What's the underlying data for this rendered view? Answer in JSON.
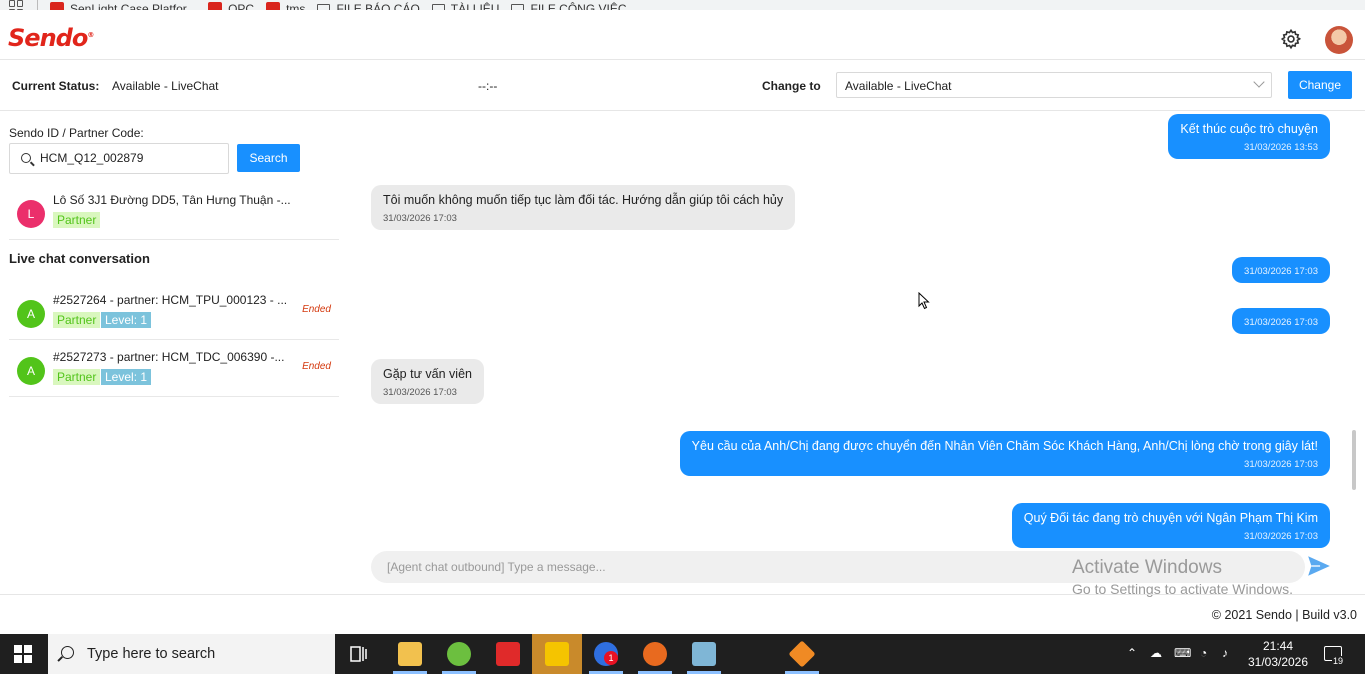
{
  "bookmarks": [
    {
      "label": "SenLight Case Platfor...",
      "icon": "sendo-red-icon"
    },
    {
      "label": "OPC",
      "icon": "sendo-red-icon"
    },
    {
      "label": "tms",
      "icon": "sendo-red-icon"
    },
    {
      "label": "FILE BÁO CÁO",
      "icon": "folder-icon"
    },
    {
      "label": "TÀI LIỆU",
      "icon": "folder-icon"
    },
    {
      "label": "FILE CÔNG VIỆC",
      "icon": "folder-icon"
    }
  ],
  "header": {
    "logo": "Sendo",
    "logo_mark": "®"
  },
  "status": {
    "current_label": "Current Status:",
    "current_value": "Available - LiveChat",
    "timer": "--:--",
    "change_to_label": "Change to",
    "select_value": "Available - LiveChat",
    "change_button": "Change"
  },
  "left": {
    "search_label": "Sendo ID / Partner Code:",
    "search_value": "HCM_Q12_002879",
    "search_button": "Search",
    "result": {
      "initial": "L",
      "title": "Lô Số 3J1 Đường DD5, Tân Hưng Thuận -...",
      "tag": "Partner"
    },
    "live_chat_heading": "Live chat conversation",
    "conversations": [
      {
        "initial": "A",
        "title": "#2527264 - partner: HCM_TPU_000123 - ...",
        "tag": "Partner",
        "level": "Level: 1",
        "status": "Ended"
      },
      {
        "initial": "A",
        "title": "#2527273 - partner: HCM_TDC_006390 -...",
        "tag": "Partner",
        "level": "Level: 1",
        "status": "Ended"
      }
    ]
  },
  "chat": {
    "messages": [
      {
        "dir": "out",
        "text": "Kết thúc cuộc trò chuyện",
        "time": "31/03/2026 13:53"
      },
      {
        "dir": "in",
        "text": "Tôi muốn không muốn tiếp tục làm đối tác. Hướng dẫn giúp tôi cách hủy",
        "time": "31/03/2026 17:03"
      },
      {
        "dir": "out",
        "text": "",
        "time": "31/03/2026 17:03"
      },
      {
        "dir": "out",
        "text": "",
        "time": "31/03/2026 17:03"
      },
      {
        "dir": "in",
        "text": "Gặp tư vấn viên",
        "time": "31/03/2026 17:03"
      },
      {
        "dir": "out",
        "text": "Yêu cầu của Anh/Chị đang được chuyển đến Nhân Viên Chăm Sóc Khách Hàng, Anh/Chị lòng chờ trong giây lát!",
        "time": "31/03/2026 17:03"
      },
      {
        "dir": "out",
        "text": "Quý Đối tác đang trò chuyện với Ngân Phạm Thị Kim",
        "time": "31/03/2026 17:03"
      }
    ],
    "composer_placeholder": "[Agent chat outbound] Type a message..."
  },
  "watermark": {
    "line1": "Activate Windows",
    "line2": "Go to Settings to activate Windows."
  },
  "footer": {
    "text": "© 2021 Sendo | Build v3.0"
  },
  "taskbar": {
    "search_placeholder": "Type here to search",
    "zalo_badge": "1",
    "time": "21:44",
    "date": "31/03/2026",
    "notifications": "19"
  },
  "colors": {
    "brand": "#e1251b",
    "primary": "#1890ff",
    "incoming_bubble": "#eaeaea"
  }
}
